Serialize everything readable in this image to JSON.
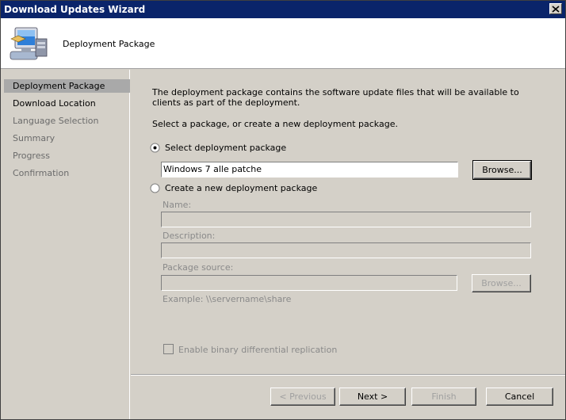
{
  "window": {
    "title": "Download Updates Wizard"
  },
  "header": {
    "title": "Deployment Package",
    "icon": "computer-package-icon"
  },
  "sidebar": {
    "items": [
      {
        "label": "Deployment Package",
        "state": "active"
      },
      {
        "label": "Download Location",
        "state": "enabled"
      },
      {
        "label": "Language Selection",
        "state": "disabled"
      },
      {
        "label": "Summary",
        "state": "disabled"
      },
      {
        "label": "Progress",
        "state": "disabled"
      },
      {
        "label": "Confirmation",
        "state": "disabled"
      }
    ]
  },
  "main": {
    "description": "The deployment package contains the software update files that will be available to clients as part of the deployment.",
    "prompt": "Select a package, or create a new deployment package.",
    "select_option": {
      "label": "Select deployment package",
      "selected": true
    },
    "selected_package": "Windows 7 alle patche",
    "browse_label": "Browse...",
    "create_option": {
      "label": "Create a new deployment package",
      "selected": false
    },
    "name_label": "Name:",
    "description_label": "Description:",
    "package_source_label": "Package source:",
    "source_browse_label": "Browse...",
    "example_text": "Example: \\\\servername\\share",
    "binary_diff_label": "Enable binary differential replication"
  },
  "footer": {
    "previous": "< Previous",
    "next": "Next >",
    "finish": "Finish",
    "cancel": "Cancel"
  }
}
